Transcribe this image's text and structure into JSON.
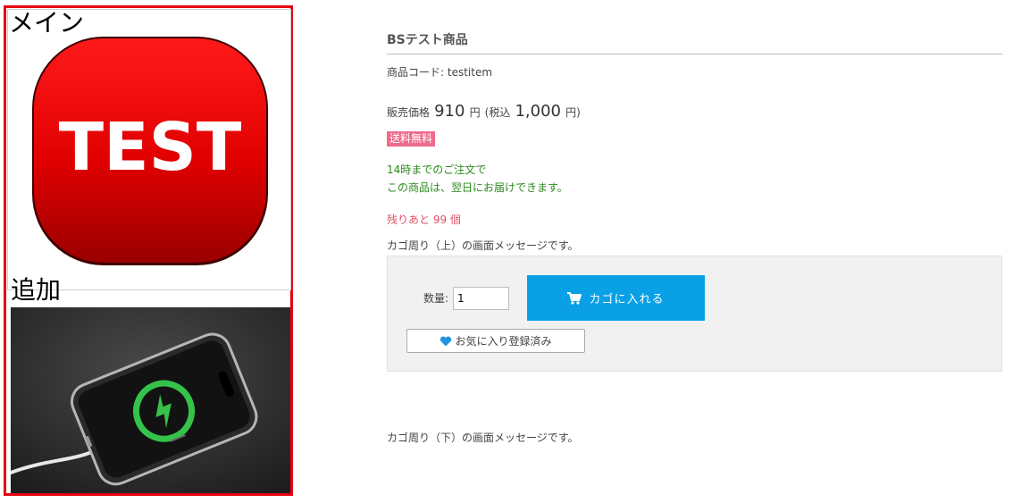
{
  "gallery": {
    "main_caption": "メイン",
    "sub_caption": "追加",
    "main_image": {
      "text": "TEST",
      "color": "#e00000"
    },
    "sub_image_icon": "wireless-charging-phone-photo"
  },
  "product": {
    "name": "BSテスト商品",
    "code_label": "商品コード:",
    "code_value": "testitem",
    "price_label": "販売価格",
    "price_value": "910",
    "yen": "円",
    "tax_open": "(税込",
    "tax_price": "1,000",
    "tax_close": "円)",
    "badge": "送料無料",
    "shipping_line1": "14時までのご注文で",
    "shipping_line2": "この商品は、翌日にお届けできます。",
    "stock": "残りあと 99 個",
    "message_top": "カゴ周り（上）の画面メッセージです。",
    "message_bottom": "カゴ周り（下）の画面メッセージです。"
  },
  "cart": {
    "qty_label": "数量:",
    "qty_value": "1",
    "add_button": "カゴに入れる",
    "add_icon": "cart-icon",
    "fav_button": "お気に入り登録済み",
    "fav_icon": "heart-icon"
  },
  "colors": {
    "accent": "#0aa0e6",
    "badge": "#ee6a8c",
    "shipping": "#2b8a1c",
    "stock": "#e05262",
    "frame": "#e60012"
  }
}
